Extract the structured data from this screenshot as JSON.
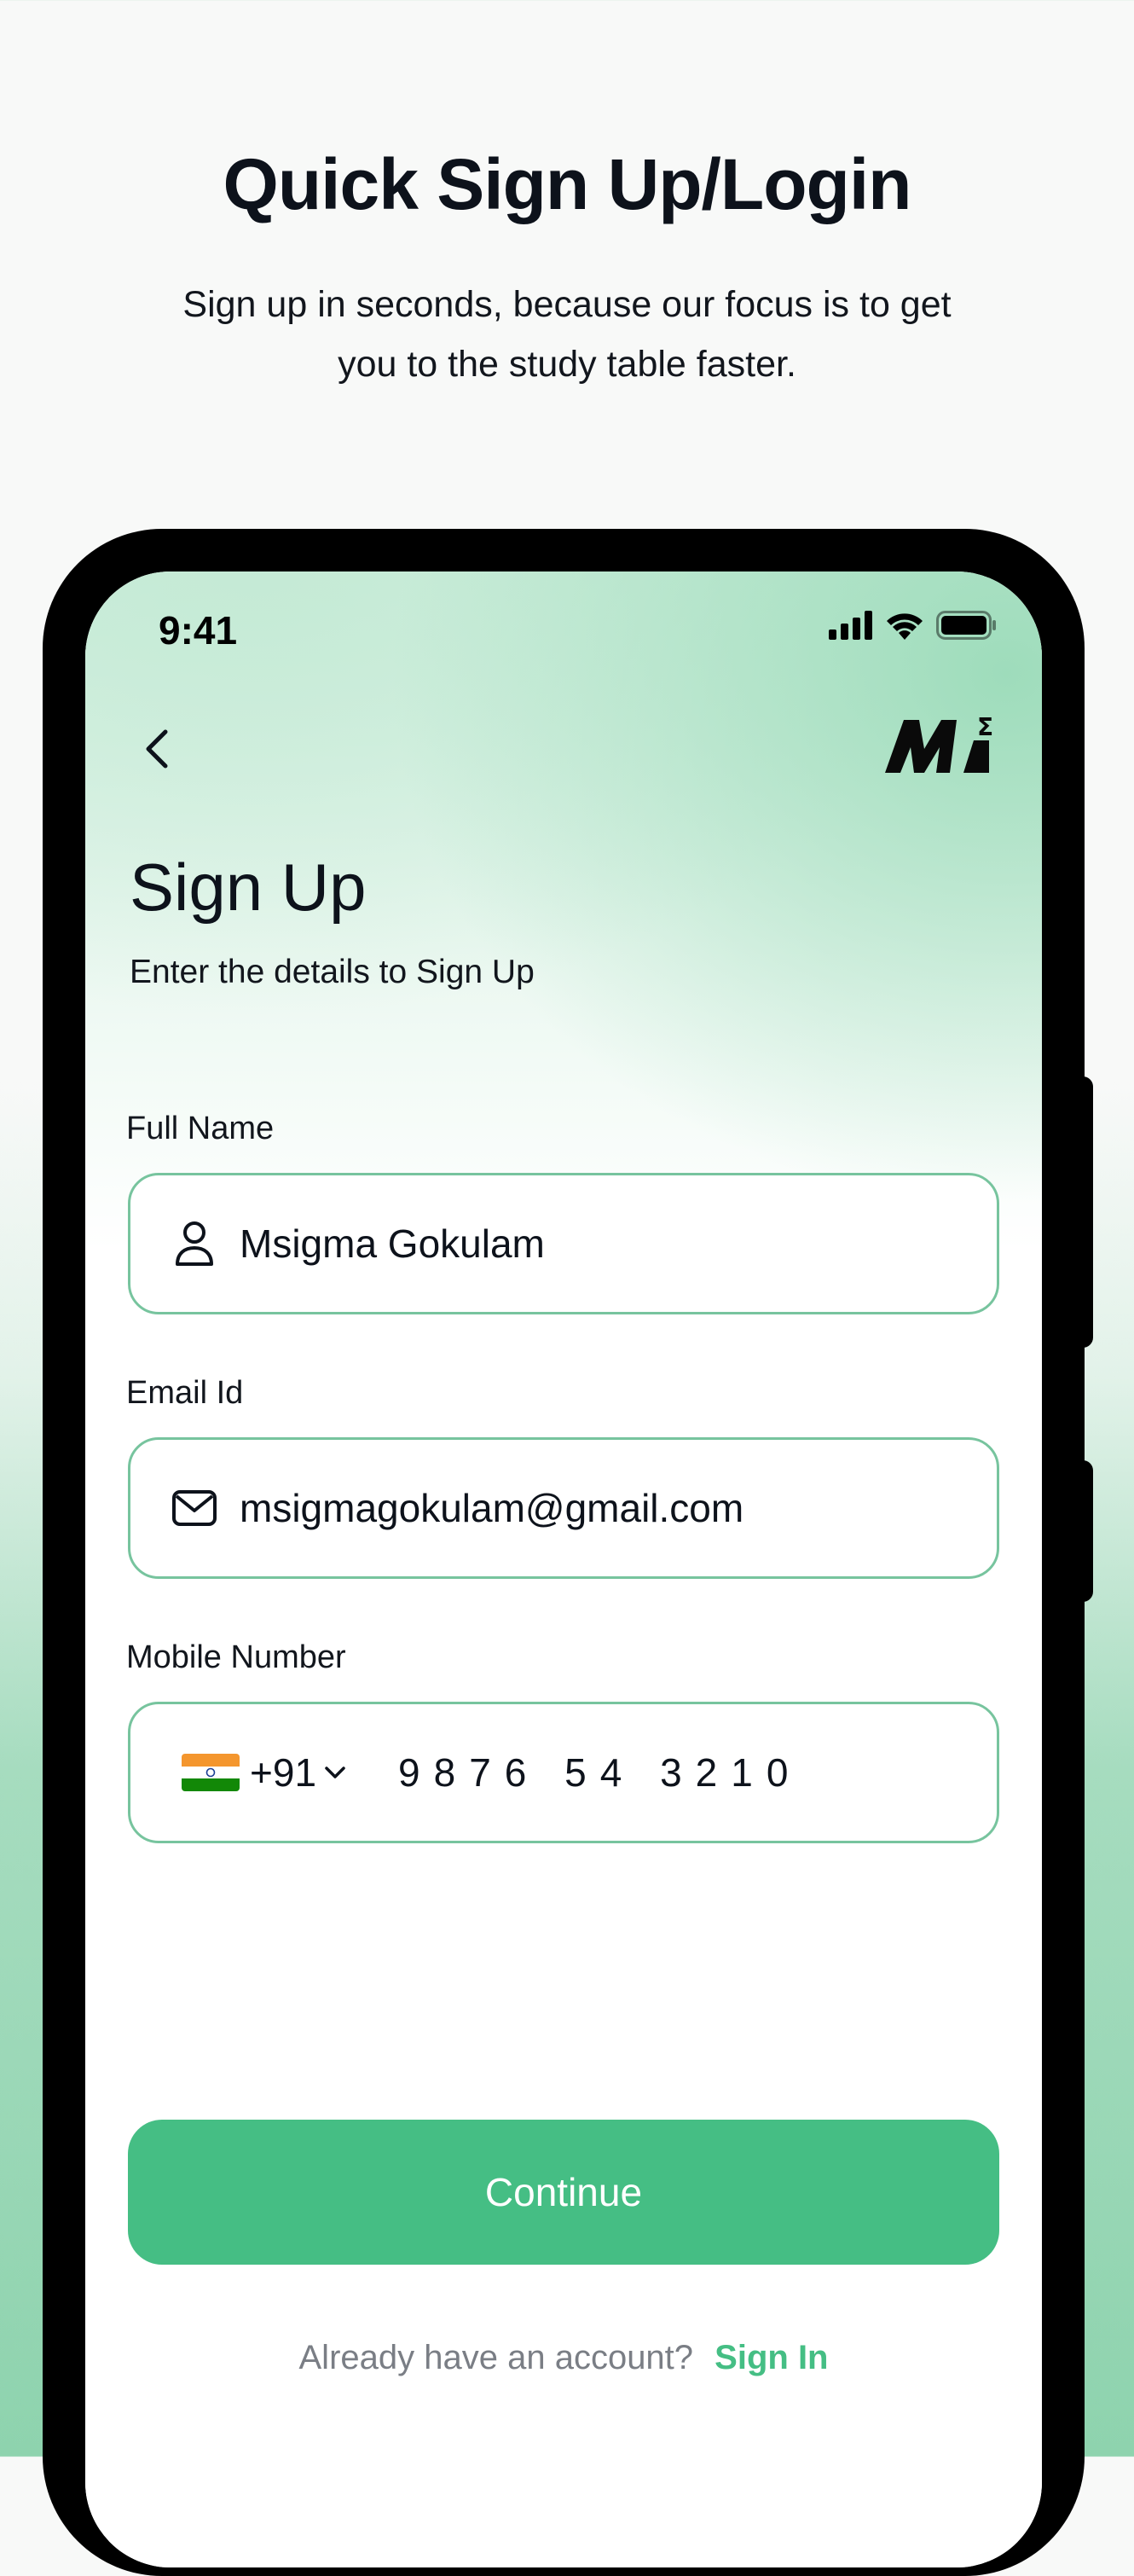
{
  "promo": {
    "title": "Quick Sign Up/Login",
    "subtitle": "Sign up in seconds, because our focus is to get you to the study table faster."
  },
  "status_bar": {
    "time": "9:41",
    "icons": [
      "cellular-signal-icon",
      "wifi-icon",
      "battery-icon"
    ]
  },
  "nav": {
    "back_icon": "chevron-left-icon",
    "logo": "m-sigma-logo"
  },
  "form": {
    "title": "Sign Up",
    "subtitle": "Enter the details to Sign Up",
    "full_name": {
      "label": "Full Name",
      "value": "Msigma Gokulam",
      "icon": "user-icon"
    },
    "email": {
      "label": "Email Id",
      "value": "msigmagokulam@gmail.com",
      "icon": "mail-icon"
    },
    "mobile": {
      "label": "Mobile Number",
      "country_flag": "india-flag-icon",
      "country_code": "+91",
      "value": "9876 54 3210"
    },
    "continue_label": "Continue",
    "signin_prompt": "Already have an account?",
    "signin_link": "Sign In"
  },
  "colors": {
    "accent": "#45be84",
    "field_border": "#77c49e",
    "text": "#0d121b",
    "muted": "#7a7e85"
  }
}
